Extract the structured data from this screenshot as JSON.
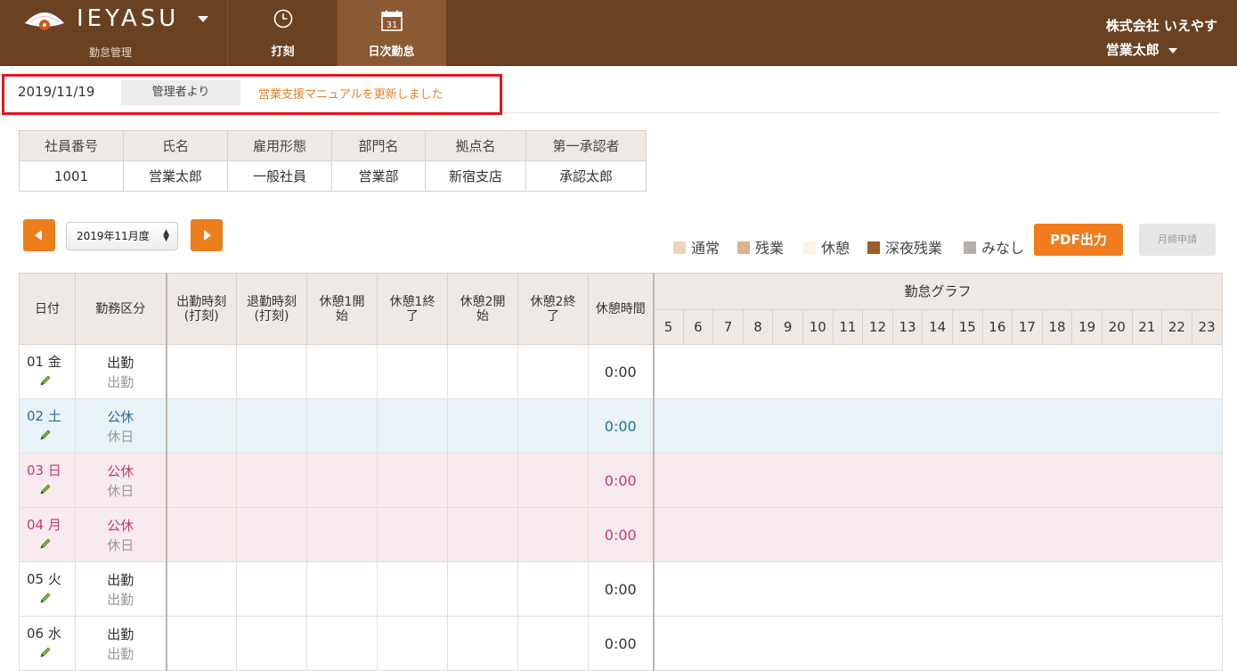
{
  "header": {
    "logo_text": "IEYASU",
    "subtitle": "勤怠管理",
    "nav": [
      {
        "label": "打刻",
        "icon": "clock-icon",
        "active": false
      },
      {
        "label": "日次勤怠",
        "icon": "calendar-icon",
        "icon_text": "31",
        "active": true
      }
    ],
    "company": "株式会社 いえやす",
    "user": "営業太郎"
  },
  "notice": {
    "date": "2019/11/19",
    "from": "管理者より",
    "message": "営業支援マニュアルを更新しました"
  },
  "employee": {
    "headers": [
      "社員番号",
      "氏名",
      "雇用形態",
      "部門名",
      "拠点名",
      "第一承認者"
    ],
    "values": [
      "1001",
      "営業太郎",
      "一般社員",
      "営業部",
      "新宿支店",
      "承認太郎"
    ]
  },
  "controls": {
    "period": "2019年11月度",
    "pdf_label": "PDF出力",
    "monthly_label": "月締申請"
  },
  "legend": [
    {
      "label": "通常",
      "color": "#edd2b6"
    },
    {
      "label": "残業",
      "color": "#d9b391"
    },
    {
      "label": "休憩",
      "color": "#fbf3ea"
    },
    {
      "label": "深夜残業",
      "color": "#9b5e2c"
    },
    {
      "label": "みなし",
      "color": "#b4b0ad"
    }
  ],
  "table": {
    "headers": {
      "date": "日付",
      "kind": "勤務区分",
      "clock_in": [
        "出勤時刻",
        "(打刻)"
      ],
      "clock_out": [
        "退勤時刻",
        "(打刻)"
      ],
      "break1_start": [
        "休憩1開",
        "始"
      ],
      "break1_end": [
        "休憩1終",
        "了"
      ],
      "break2_start": [
        "休憩2開",
        "始"
      ],
      "break2_end": [
        "休憩2終",
        "了"
      ],
      "break_time": "休憩時間",
      "graph": "勤怠グラフ"
    },
    "hours": [
      "5",
      "6",
      "7",
      "8",
      "9",
      "10",
      "11",
      "12",
      "13",
      "14",
      "15",
      "16",
      "17",
      "18",
      "19",
      "20",
      "21",
      "22",
      "23"
    ],
    "rows": [
      {
        "day": "01",
        "weekday": "金",
        "kind": "出勤",
        "kind2": "出勤",
        "break_time": "0:00",
        "type": "norm"
      },
      {
        "day": "02",
        "weekday": "土",
        "kind": "公休",
        "kind2": "休日",
        "break_time": "0:00",
        "type": "sat"
      },
      {
        "day": "03",
        "weekday": "日",
        "kind": "公休",
        "kind2": "休日",
        "break_time": "0:00",
        "type": "hol"
      },
      {
        "day": "04",
        "weekday": "月",
        "kind": "公休",
        "kind2": "休日",
        "break_time": "0:00",
        "type": "hol"
      },
      {
        "day": "05",
        "weekday": "火",
        "kind": "出勤",
        "kind2": "出勤",
        "break_time": "0:00",
        "type": "norm"
      },
      {
        "day": "06",
        "weekday": "水",
        "kind": "出勤",
        "kind2": "出勤",
        "break_time": "0:00",
        "type": "norm"
      }
    ]
  }
}
